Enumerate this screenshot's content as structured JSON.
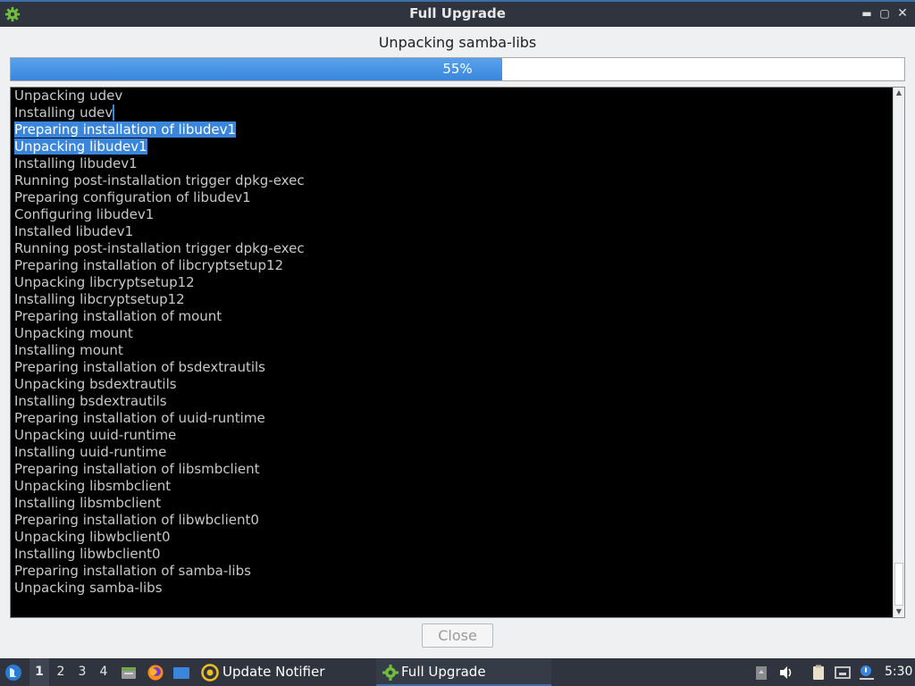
{
  "window": {
    "title": "Full Upgrade",
    "minimize_icon": "minimize-icon",
    "maximize_icon": "maximize-icon",
    "close_icon": "close-icon"
  },
  "status": {
    "current_action": "Unpacking samba-libs",
    "progress_percent": 55,
    "progress_label": "55%"
  },
  "log": {
    "lines": [
      "Unpacking udev",
      "Installing udev",
      "Preparing installation of libudev1",
      "Unpacking libudev1",
      "Installing libudev1",
      "Running post-installation trigger dpkg-exec",
      "Preparing configuration of libudev1",
      "Configuring libudev1",
      "Installed libudev1",
      "Running post-installation trigger dpkg-exec",
      "Preparing installation of libcryptsetup12",
      "Unpacking libcryptsetup12",
      "Installing libcryptsetup12",
      "Preparing installation of mount",
      "Unpacking mount",
      "Installing mount",
      "Preparing installation of bsdextrautils",
      "Unpacking bsdextrautils",
      "Installing bsdextrautils",
      "Preparing installation of uuid-runtime",
      "Unpacking uuid-runtime",
      "Installing uuid-runtime",
      "Preparing installation of libsmbclient",
      "Unpacking libsmbclient",
      "Installing libsmbclient",
      "Preparing installation of libwbclient0",
      "Unpacking libwbclient0",
      "Installing libwbclient0",
      "Preparing installation of samba-libs",
      "Unpacking samba-libs"
    ],
    "selected_lines": [
      2,
      3
    ]
  },
  "buttons": {
    "close_label": "Close"
  },
  "taskbar": {
    "menu_icon": "start-menu-icon",
    "desktops": [
      "1",
      "2",
      "3",
      "4"
    ],
    "active_desktop": "1",
    "launchers": [
      "file-manager-icon",
      "firefox-icon",
      "desktop-icon"
    ],
    "tasks": [
      {
        "label": "Update Notifier",
        "icon": "update-notifier-icon",
        "active": false
      },
      {
        "label": "Full Upgrade",
        "icon": "gear-icon",
        "active": true
      }
    ],
    "tray_icons": [
      "removable-media-icon",
      "volume-icon",
      "clipboard-icon",
      "network-icon",
      "notification-icon"
    ],
    "clock": "5:30"
  },
  "colors": {
    "accent": "#3a86dc",
    "titlebar": "#2f343f",
    "log_background": "#000000",
    "log_text": "#c8c8c8"
  }
}
